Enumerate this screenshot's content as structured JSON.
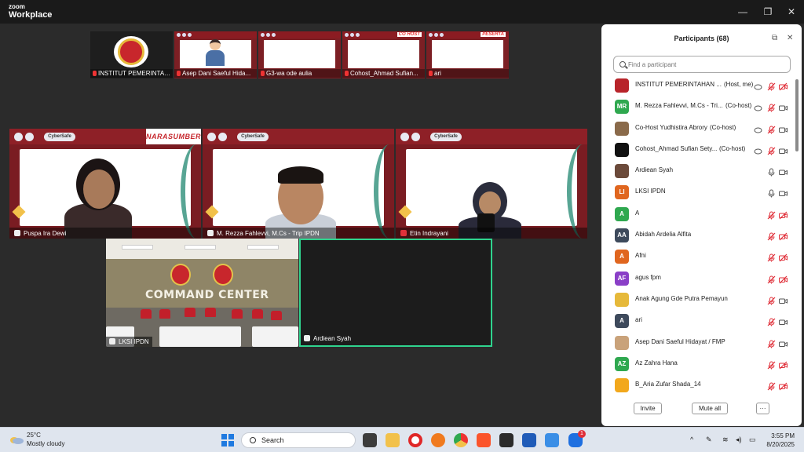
{
  "app": {
    "brand_line1": "zoom",
    "brand_line2": "Workplace"
  },
  "window_controls": {
    "minimize": "—",
    "restore": "❐",
    "close": "✕"
  },
  "filmstrip": [
    {
      "name": "INSTITUT PEMERINTAH...",
      "kind": "logo"
    },
    {
      "name": "Asep Dani Saeful Hida...",
      "kind": "avatar"
    },
    {
      "name": "G3-wa ode aulia",
      "kind": "slide"
    },
    {
      "name": "Cohost_Ahmad Sufian...",
      "kind": "slide",
      "tag": "CO HOST"
    },
    {
      "name": "ari",
      "kind": "slide",
      "tag": "PESERTA"
    }
  ],
  "speakers": [
    {
      "name": "Puspa Ira Dewi",
      "label": "CyberSafe",
      "banner": "NARASUMBER"
    },
    {
      "name": "M. Rezza Fahlevvi, M.Cs - Trip IPDN",
      "label": "CyberSafe"
    },
    {
      "name": "Etin Indrayani",
      "label": "CyberSafe"
    }
  ],
  "bottom_tiles": [
    {
      "name": "LKSI IPDN",
      "sign": "COMMAND CENTER"
    },
    {
      "name": "Ardiean Syah"
    }
  ],
  "panel": {
    "title": "Participants (68)",
    "search_placeholder": "Find a participant",
    "invite_label": "Invite",
    "mute_all_label": "Mute all",
    "more_label": "···",
    "participants": [
      {
        "name": "INSTITUT PEMERINTAHAN ...",
        "tag": "(Host, me)",
        "initials": "",
        "color": "#b8242a",
        "mic": "muted",
        "cam": "off",
        "share": true
      },
      {
        "name": "M. Rezza Fahlevvi, M.Cs - Tri...",
        "tag": "(Co-host)",
        "initials": "MR",
        "color": "#2fa84f",
        "mic": "muted",
        "cam": "on",
        "share": true
      },
      {
        "name": "Co-Host Yudhistira Abrory",
        "tag": "(Co-host)",
        "initials": "",
        "color": "#8a6a4a",
        "mic": "muted",
        "cam": "on",
        "share": true
      },
      {
        "name": "Cohost_Ahmad Sufian Sety...",
        "tag": "(Co-host)",
        "initials": "",
        "color": "#111111",
        "mic": "muted",
        "cam": "on",
        "share": true
      },
      {
        "name": "Ardiean Syah",
        "tag": "",
        "initials": "",
        "color": "#6b4a3a",
        "mic": "on",
        "cam": "on",
        "share": false
      },
      {
        "name": "LKSI IPDN",
        "tag": "",
        "initials": "LI",
        "color": "#e0661f",
        "mic": "on",
        "cam": "on",
        "share": false
      },
      {
        "name": "A",
        "tag": "",
        "initials": "A",
        "color": "#2fa84f",
        "mic": "muted",
        "cam": "off",
        "share": false
      },
      {
        "name": "Abidah Ardelia Alfita",
        "tag": "",
        "initials": "AA",
        "color": "#3e4a5c",
        "mic": "muted",
        "cam": "off",
        "share": false
      },
      {
        "name": "Afni",
        "tag": "",
        "initials": "A",
        "color": "#e0661f",
        "mic": "muted",
        "cam": "off",
        "share": false
      },
      {
        "name": "agus fpm",
        "tag": "",
        "initials": "AF",
        "color": "#8a3fc7",
        "mic": "muted",
        "cam": "off",
        "share": false
      },
      {
        "name": "Anak Agung Gde Putra Pemayun",
        "tag": "",
        "initials": "",
        "color": "#e6b93a",
        "mic": "muted",
        "cam": "on",
        "share": false
      },
      {
        "name": "ari",
        "tag": "",
        "initials": "A",
        "color": "#3e4a5c",
        "mic": "muted",
        "cam": "on",
        "share": false
      },
      {
        "name": "Asep Dani Saeful Hidayat / FMP",
        "tag": "",
        "initials": "",
        "color": "#c9a27a",
        "mic": "muted",
        "cam": "on",
        "share": false
      },
      {
        "name": "Az Zahra Hana",
        "tag": "",
        "initials": "AZ",
        "color": "#2fa84f",
        "mic": "muted",
        "cam": "off",
        "share": false
      },
      {
        "name": "B_Aria Zufar Shada_14",
        "tag": "",
        "initials": "",
        "color": "#f2a81c",
        "mic": "muted",
        "cam": "off",
        "share": false
      }
    ]
  },
  "taskbar": {
    "temp": "25°C",
    "weather": "Mostly cloudy",
    "search": "Search",
    "time": "3:55 PM",
    "date": "8/20/2025",
    "tray_chevron": "^",
    "notification_count": "1"
  },
  "colors": {
    "accent_green": "#2fd48e",
    "muted_red": "#e0303a",
    "brand_maroon": "#7a1c22"
  }
}
